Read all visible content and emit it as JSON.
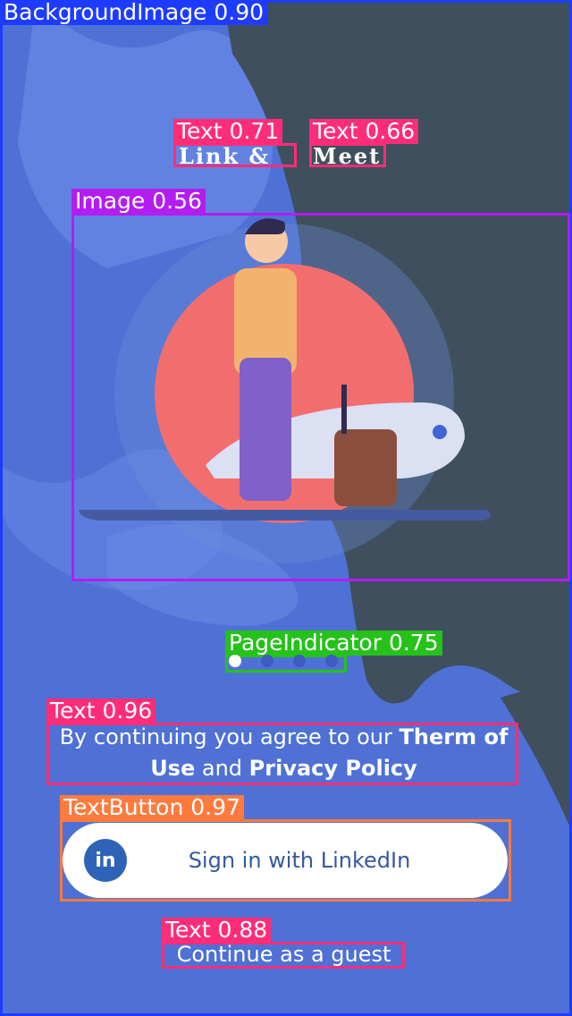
{
  "overlay_labels": {
    "background": "BackgroundImage 0.90",
    "text_link": "Text 0.71",
    "text_meet": "Text 0.66",
    "image": "Image 0.56",
    "page_indicator": "PageIndicator 0.75",
    "text_terms": "Text 0.96",
    "text_button": "TextButton 0.97",
    "text_guest": "Text 0.88"
  },
  "title": {
    "word1": "Link &",
    "word2": "Meet"
  },
  "page_indicator": {
    "count": 4,
    "active_index": 0
  },
  "terms": {
    "prefix": "By continuing you agree to our ",
    "term1": "Therm of Use",
    "middle": " and ",
    "term2": "Privacy Policy"
  },
  "linkedin_button": {
    "icon_text": "in",
    "label": "Sign in with LinkedIn"
  },
  "guest_link": "Continue as a guest",
  "colors": {
    "background": "#5b7fe0",
    "dark_shape": "#3f4f5e",
    "detect_blue": "#1e3cff",
    "detect_pink": "#ff2d78",
    "detect_purple": "#b21df0",
    "detect_green": "#25c21a",
    "detect_orange": "#ff7a3d"
  }
}
